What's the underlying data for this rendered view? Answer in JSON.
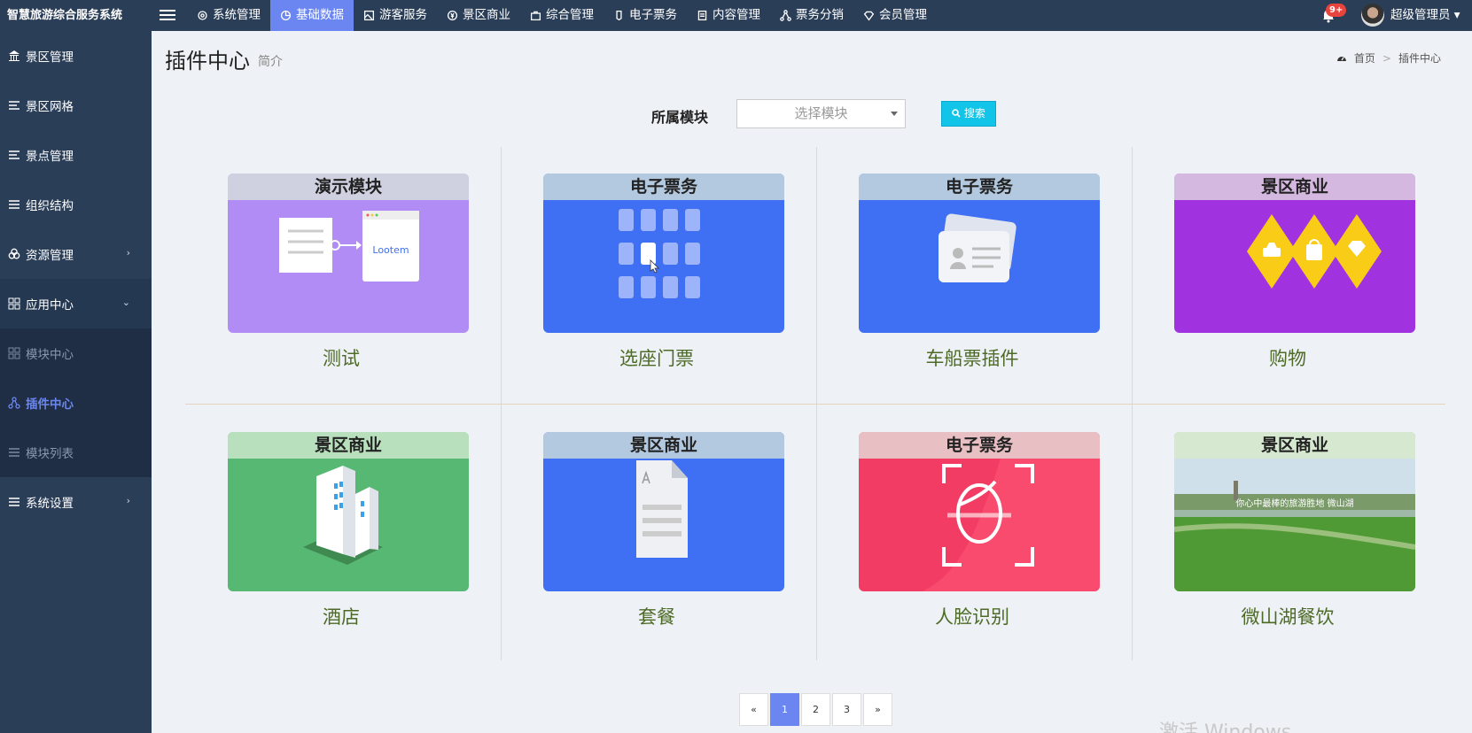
{
  "app": {
    "title": "智慧旅游综合服务系统"
  },
  "topnav": [
    {
      "label": "系统管理",
      "icon": "gear-icon"
    },
    {
      "label": "基础数据",
      "icon": "pie-icon",
      "active": true
    },
    {
      "label": "游客服务",
      "icon": "image-icon"
    },
    {
      "label": "景区商业",
      "icon": "coin-icon"
    },
    {
      "label": "综合管理",
      "icon": "briefcase-icon"
    },
    {
      "label": "电子票务",
      "icon": "ticket-icon"
    },
    {
      "label": "内容管理",
      "icon": "doc-icon"
    },
    {
      "label": "票务分销",
      "icon": "share-icon"
    },
    {
      "label": "会员管理",
      "icon": "diamond-icon"
    }
  ],
  "header": {
    "notifications": "9+",
    "user": "超级管理员"
  },
  "sidebar": {
    "items": [
      {
        "label": "景区管理",
        "icon": "bank-icon"
      },
      {
        "label": "景区网格",
        "icon": "list-icon"
      },
      {
        "label": "景点管理",
        "icon": "list-icon"
      },
      {
        "label": "组织结构",
        "icon": "list-icon"
      },
      {
        "label": "资源管理",
        "icon": "cubes-icon",
        "chevron": "›"
      },
      {
        "label": "应用中心",
        "icon": "grid-icon",
        "chevron": "⌄"
      },
      {
        "label": "模块中心",
        "icon": "grid-icon",
        "sub": true
      },
      {
        "label": "插件中心",
        "icon": "share-icon",
        "sub": true,
        "active": true
      },
      {
        "label": "模块列表",
        "icon": "list-icon",
        "sub": true
      },
      {
        "label": "系统设置",
        "icon": "list-icon",
        "chevron": "›"
      }
    ]
  },
  "page": {
    "title": "插件中心",
    "subtitle": "简介"
  },
  "breadcrumb": {
    "home": "首页",
    "sep": ">",
    "current": "插件中心"
  },
  "filter": {
    "label": "所属模块",
    "placeholder": "选择模块",
    "search_label": "搜索"
  },
  "cards": [
    {
      "tag": "演示模块",
      "name": "测试",
      "tag_bg": "#cfd0e0",
      "bg": "#b18cf5",
      "logo_text": "Lootem"
    },
    {
      "tag": "电子票务",
      "name": "选座门票",
      "tag_bg": "#b3c9e0",
      "bg": "#3f6ff2"
    },
    {
      "tag": "电子票务",
      "name": "车船票插件",
      "tag_bg": "#b3c9e0",
      "bg": "#3f6ff2"
    },
    {
      "tag": "景区商业",
      "name": "购物",
      "tag_bg": "#d4b8e0",
      "bg": "#a132df"
    },
    {
      "tag": "景区商业",
      "name": "酒店",
      "tag_bg": "#b9e0bd",
      "bg": "#56b873"
    },
    {
      "tag": "景区商业",
      "name": "套餐",
      "tag_bg": "#b3c9e0",
      "bg": "#3f6ff2"
    },
    {
      "tag": "电子票务",
      "name": "人脸识别",
      "tag_bg": "#e8bfc2",
      "bg": "#f33c63"
    },
    {
      "tag": "景区商业",
      "name": "微山湖餐饮",
      "tag_bg": "#d6e8d0",
      "bg": "#6fa05a",
      "photo_caption": "你心中最棒的旅游胜地 微山湖"
    }
  ],
  "pagination": {
    "prev": "«",
    "pages": [
      "1",
      "2",
      "3"
    ],
    "current": "1",
    "next": "»"
  },
  "watermark": "激活 Windows"
}
